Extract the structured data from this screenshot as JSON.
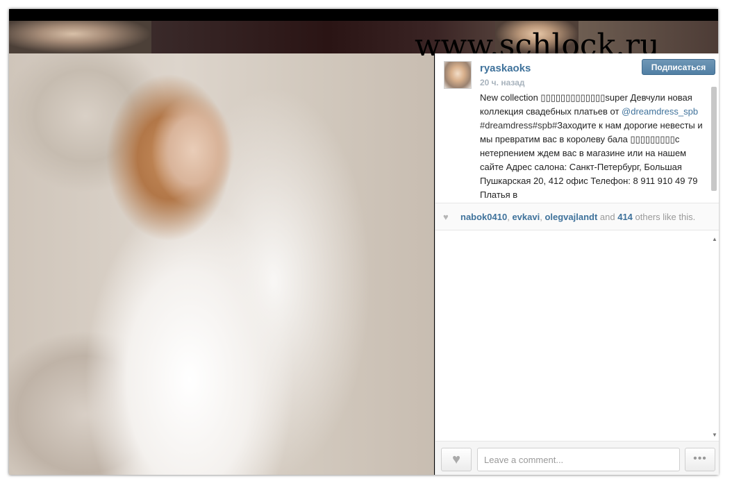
{
  "watermark": "www.schlock.ru",
  "post": {
    "username": "ryaskaoks",
    "time_ago": "20 ч. назад",
    "follow_label": "Подписаться",
    "caption": {
      "part1": "New collection ▯▯▯▯▯▯▯▯▯▯▯▯▯super Девчули новая коллекция свадебных платьев от ",
      "mention": "@dreamdress_spb",
      "hashtags": " #dreamdress#spb#",
      "part2": "Заходите к нам дорогие невесты и мы превратим вас в королеву бала ▯▯▯▯▯▯▯▯▯с нетерпением ждем вас в магазине или на нашем сайте Адрес салона: Санкт-Петербург, Большая Пушкарская 20, 412 офис Телефон: 8 911 910 49 79 Платья в"
    }
  },
  "likes": {
    "icon": "heart-icon",
    "users": [
      "nabok0410",
      "evkavi",
      "olegvajlandt"
    ],
    "sep1": ", ",
    "sep2": ", ",
    "and": " and ",
    "count": "414",
    "suffix": " others like this."
  },
  "footer": {
    "like_icon": "heart-icon",
    "comment_placeholder": "Leave a comment...",
    "more_label": "•••"
  },
  "scroll": {
    "up": "▲",
    "down": "▼"
  }
}
